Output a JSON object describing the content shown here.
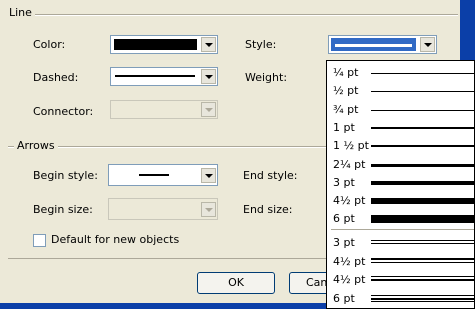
{
  "line_group": {
    "title": "Line",
    "color_label": "Color:",
    "dashed_label": "Dashed:",
    "connector_label": "Connector:",
    "style_label": "Style:",
    "weight_label": "Weight:"
  },
  "arrows_group": {
    "title": "Arrows",
    "begin_style_label": "Begin style:",
    "begin_size_label": "Begin size:",
    "end_style_label": "End style:",
    "end_size_label": "End size:"
  },
  "default_checkbox": {
    "label": "Default for new objects",
    "checked": false
  },
  "buttons": {
    "ok": "OK",
    "cancel": "Can"
  },
  "style_dropdown": {
    "single_lines": [
      {
        "label": "¼ pt",
        "weight": 1
      },
      {
        "label": "½ pt",
        "weight": 1
      },
      {
        "label": "¾ pt",
        "weight": 1
      },
      {
        "label": "1 pt",
        "weight": 2
      },
      {
        "label": "1 ½ pt",
        "weight": 2
      },
      {
        "label": "2¼ pt",
        "weight": 3
      },
      {
        "label": "3 pt",
        "weight": 4
      },
      {
        "label": "4½ pt",
        "weight": 6
      },
      {
        "label": "6 pt",
        "weight": 8
      }
    ],
    "multi_lines": [
      {
        "label": "3 pt",
        "kind": "double"
      },
      {
        "label": "4½ pt",
        "kind": "thick-thin"
      },
      {
        "label": "4½ pt",
        "kind": "thin-thick"
      },
      {
        "label": "6 pt",
        "kind": "triple"
      }
    ]
  },
  "colors": {
    "dialog_bg": "#ece9d8",
    "selection": "#316ac5",
    "frame_blue": "#0b3fa8"
  }
}
